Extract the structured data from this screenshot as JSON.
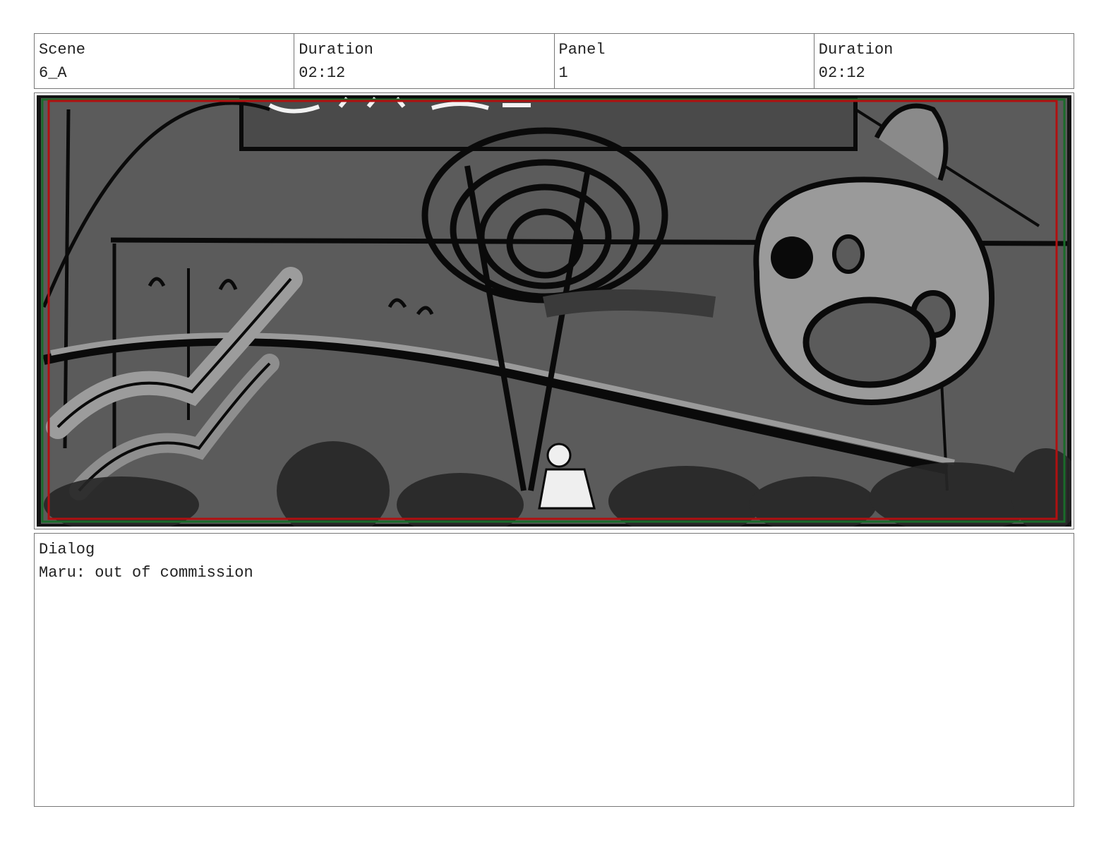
{
  "header": {
    "scene_label": "Scene",
    "scene_value": "6_A",
    "duration_label": "Duration",
    "duration_value": "02:12",
    "panel_label": "Panel",
    "panel_value": "1",
    "panel_duration_label": "Duration",
    "panel_duration_value": "02:12"
  },
  "panel_image": {
    "description_icon": "storyboard-sketch-image",
    "safe_frame_color": "#b01010",
    "title_safe_color": "#1a6b2a"
  },
  "dialog": {
    "label": "Dialog",
    "text": "Maru: out of commission"
  }
}
